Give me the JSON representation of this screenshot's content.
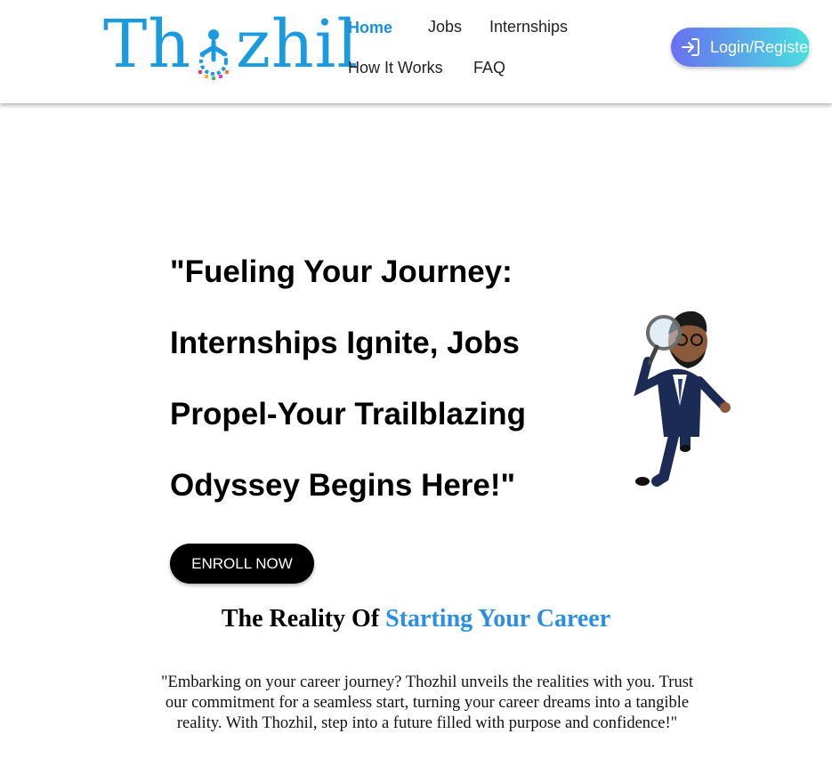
{
  "brand": {
    "logo_prefix": "Th",
    "logo_suffix": "zhil",
    "logo_color": "#1a9be0"
  },
  "nav": {
    "items": [
      {
        "label": "Home",
        "active": true
      },
      {
        "label": "Jobs",
        "active": false
      },
      {
        "label": "Internships",
        "active": false
      },
      {
        "label": "How It Works",
        "active": false
      },
      {
        "label": "FAQ",
        "active": false
      }
    ],
    "active_color": "#1a8fe0"
  },
  "header": {
    "login_label": "Login/Register",
    "login_icon": "login-arrow-icon"
  },
  "hero": {
    "lines": [
      "\"Fueling Your Journey:",
      "Internships Ignite, Jobs",
      "Propel-Your Trailblazing",
      "Odyssey Begins Here!\""
    ],
    "cta_label": "ENROLL NOW",
    "illustration": "businessman-with-magnifying-glass"
  },
  "reality": {
    "title_plain": "The Reality Of ",
    "title_accent": "Starting Your Career",
    "accent_color": "#2b8ee0",
    "body": "\"Embarking on your career journey? Thozhil unveils the realities with you. Trust our commitment for a seamless start, turning your career dreams into a tangible reality. With Thozhil, step into a future filled with purpose and confidence!\""
  }
}
